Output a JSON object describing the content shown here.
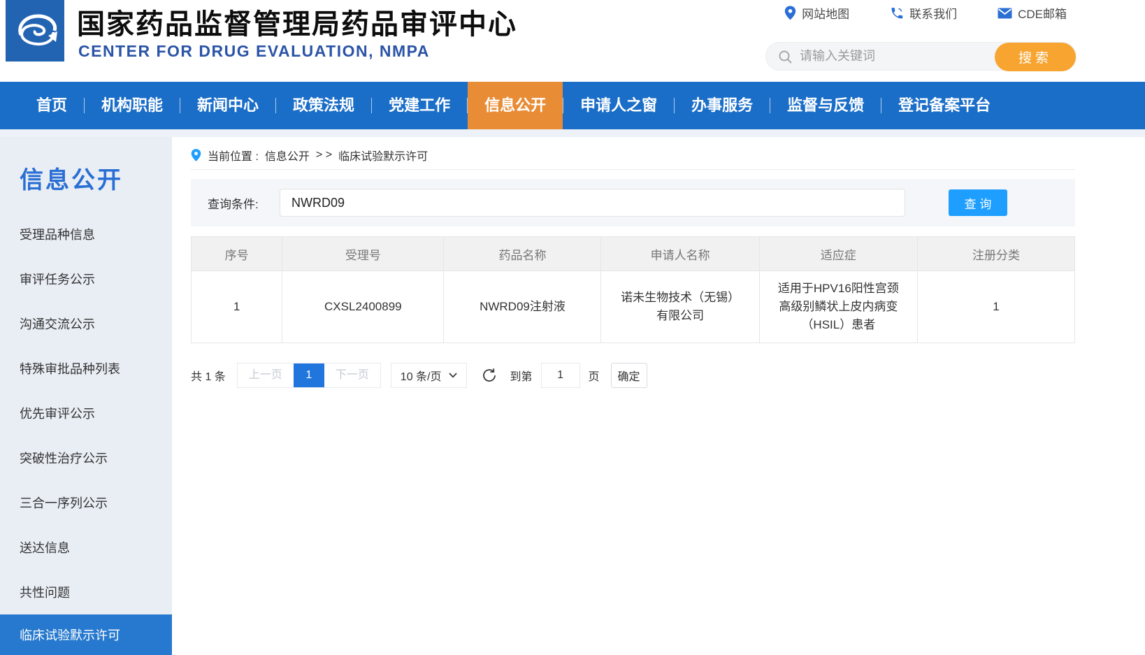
{
  "header": {
    "title": "国家药品监督管理局药品审评中心",
    "subtitle": "CENTER FOR DRUG EVALUATION, NMPA",
    "links": [
      {
        "label": "网站地图",
        "icon": "map-pin-icon"
      },
      {
        "label": "联系我们",
        "icon": "phone-icon"
      },
      {
        "label": "CDE邮箱",
        "icon": "mail-icon"
      }
    ],
    "search": {
      "placeholder": "请输入关键词",
      "button_label": "搜索"
    }
  },
  "nav": {
    "items": [
      "首页",
      "机构职能",
      "新闻中心",
      "政策法规",
      "党建工作",
      "信息公开",
      "申请人之窗",
      "办事服务",
      "监督与反馈",
      "登记备案平台"
    ],
    "active_index": 5
  },
  "sidebar": {
    "title": "信息公开",
    "items": [
      "受理品种信息",
      "审评任务公示",
      "沟通交流公示",
      "特殊审批品种列表",
      "优先审评公示",
      "突破性治疗公示",
      "三合一序列公示",
      "送达信息",
      "共性问题",
      "临床试验默示许可"
    ],
    "active_index": 9
  },
  "breadcrumb": {
    "label": "当前位置 :",
    "section": "信息公开",
    "separator": "> >",
    "current": "临床试验默示许可"
  },
  "query": {
    "label": "查询条件:",
    "value": "NWRD09",
    "button_label": "查 询"
  },
  "table": {
    "headers": [
      "序号",
      "受理号",
      "药品名称",
      "申请人名称",
      "适应症",
      "注册分类"
    ],
    "rows": [
      [
        "1",
        "CXSL2400899",
        "NWRD09注射液",
        "诺未生物技术（无锡）有限公司",
        "适用于HPV16阳性宫颈高级别鳞状上皮内病变（HSIL）患者",
        "1"
      ]
    ]
  },
  "pagination": {
    "total_label": "共 1 条",
    "prev_label": "上一页",
    "current_page": "1",
    "next_label": "下一页",
    "page_size": "10 条/页",
    "goto_label": "到第",
    "goto_value": "1",
    "page_unit": "页",
    "confirm_label": "确定"
  },
  "colors": {
    "nav_blue": "#1b6ec8",
    "nav_active_orange": "#e98c36",
    "sidebar_bg": "#e9eef5",
    "sidebar_active_blue": "#2679ce",
    "subtitle_blue": "#2b54a7",
    "search_button_orange": "#f7a430",
    "query_button_blue": "#1e9fff",
    "pagination_active_blue": "#2176de",
    "table_header_bg": "#f1f1f1"
  }
}
